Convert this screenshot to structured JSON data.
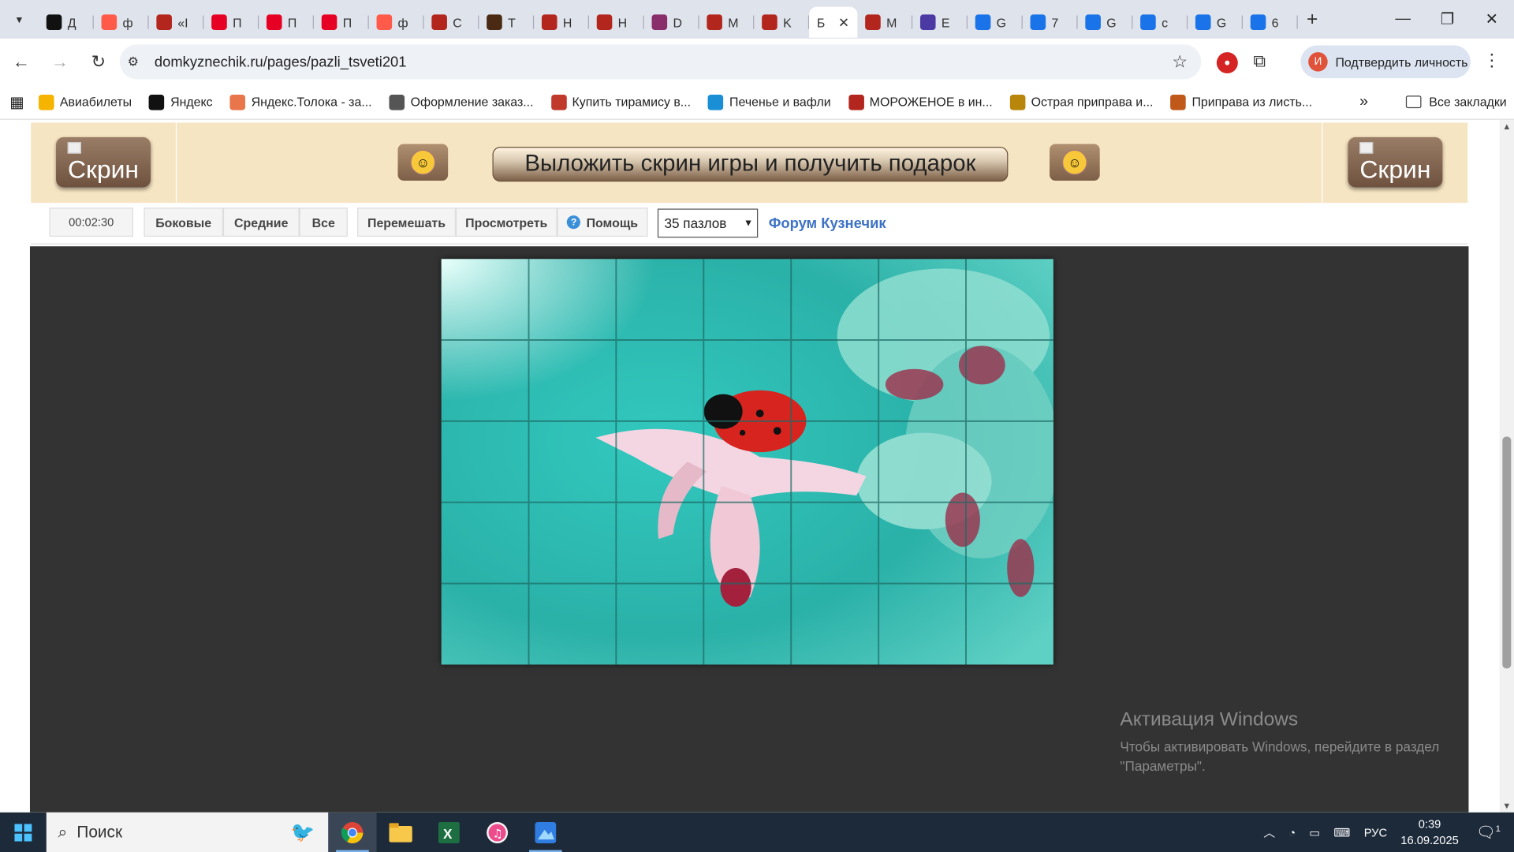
{
  "tabs": [
    {
      "label": "Д",
      "icon": "plus-icon",
      "color": "#111111"
    },
    {
      "label": "ф",
      "icon": "yandex-icon",
      "color": "#ff5a4a"
    },
    {
      "label": "«I",
      "icon": "kuznechik-icon",
      "color": "#b3261e"
    },
    {
      "label": "П",
      "icon": "pinterest-icon",
      "color": "#e60023"
    },
    {
      "label": "П",
      "icon": "pinterest-icon",
      "color": "#e60023"
    },
    {
      "label": "П",
      "icon": "pinterest-icon",
      "color": "#e60023"
    },
    {
      "label": "ф",
      "icon": "yandex-icon",
      "color": "#ff5a4a"
    },
    {
      "label": "С",
      "icon": "site2-icon",
      "color": "#b3261e"
    },
    {
      "label": "Т",
      "icon": "site-icon",
      "color": "#4a2a12"
    },
    {
      "label": "Н",
      "icon": "site2-icon",
      "color": "#b3261e"
    },
    {
      "label": "Н",
      "icon": "site2-icon",
      "color": "#b3261e"
    },
    {
      "label": "D",
      "icon": "dream-icon",
      "color": "#8a2d6b"
    },
    {
      "label": "М",
      "icon": "site2-icon",
      "color": "#b3261e"
    },
    {
      "label": "K",
      "icon": "site2-icon",
      "color": "#b3261e"
    },
    {
      "label": "Б",
      "icon": "active-tab",
      "color": "#ffffff",
      "active": true
    },
    {
      "label": "М",
      "icon": "site2-icon",
      "color": "#b3261e"
    },
    {
      "label": "E",
      "icon": "wizard-icon",
      "color": "#4b3aa3"
    },
    {
      "label": "G",
      "icon": "docs-icon",
      "color": "#1a73e8"
    },
    {
      "label": "7",
      "icon": "docs-icon",
      "color": "#1a73e8"
    },
    {
      "label": "G",
      "icon": "docs-icon",
      "color": "#1a73e8"
    },
    {
      "label": "c",
      "icon": "docs-icon",
      "color": "#1a73e8"
    },
    {
      "label": "G",
      "icon": "docs-icon",
      "color": "#1a73e8"
    },
    {
      "label": "6",
      "icon": "docs-icon",
      "color": "#1a73e8"
    }
  ],
  "address": {
    "url": "domkyznechik.ru/pages/pazli_tsveti201"
  },
  "profile": {
    "label": "Подтвердить личность",
    "initial": "И"
  },
  "bookmarks": [
    {
      "label": "Авиабилеты",
      "icon": "plane-icon",
      "color": "#f5b400"
    },
    {
      "label": "Яндекс",
      "icon": "yandex-plus-icon",
      "color": "#111111"
    },
    {
      "label": "Яндекс.Толока - за...",
      "icon": "toloka-icon",
      "color": "#e8764a"
    },
    {
      "label": "Оформление заказ...",
      "icon": "globe-icon",
      "color": "#555555"
    },
    {
      "label": "Купить тирамису в...",
      "icon": "cake-icon",
      "color": "#c0392b"
    },
    {
      "label": "Печенье и вафли",
      "icon": "cookie-icon",
      "color": "#1a8fd6"
    },
    {
      "label": "МОРОЖЕНОЕ в ин...",
      "icon": "icecream-icon",
      "color": "#b3261e"
    },
    {
      "label": "Острая приправа и...",
      "icon": "spice-icon",
      "color": "#b8860b"
    },
    {
      "label": "Приправа из листь...",
      "icon": "herb-icon",
      "color": "#c0581a"
    }
  ],
  "bookmarks_all": "Все закладки",
  "banner": {
    "skrin_left": "Скрин",
    "skrin_right": "Скрин",
    "main_button": "Выложить скрин игры и получить подарок"
  },
  "controls": {
    "timer": "00:02:30",
    "side": "Боковые",
    "middle": "Средние",
    "all": "Все",
    "shuffle": "Перемешать",
    "preview": "Просмотреть",
    "help": "Помощь",
    "select_value": "35 пазлов",
    "forum": "Форум Кузнечик"
  },
  "watermark": {
    "title": "Активация Windows",
    "line": "Чтобы активировать Windows, перейдите в раздел \"Параметры\"."
  },
  "taskbar": {
    "search": "Поиск",
    "lang": "РУС",
    "time": "0:39",
    "date": "16.09.2025",
    "notif": "1"
  }
}
